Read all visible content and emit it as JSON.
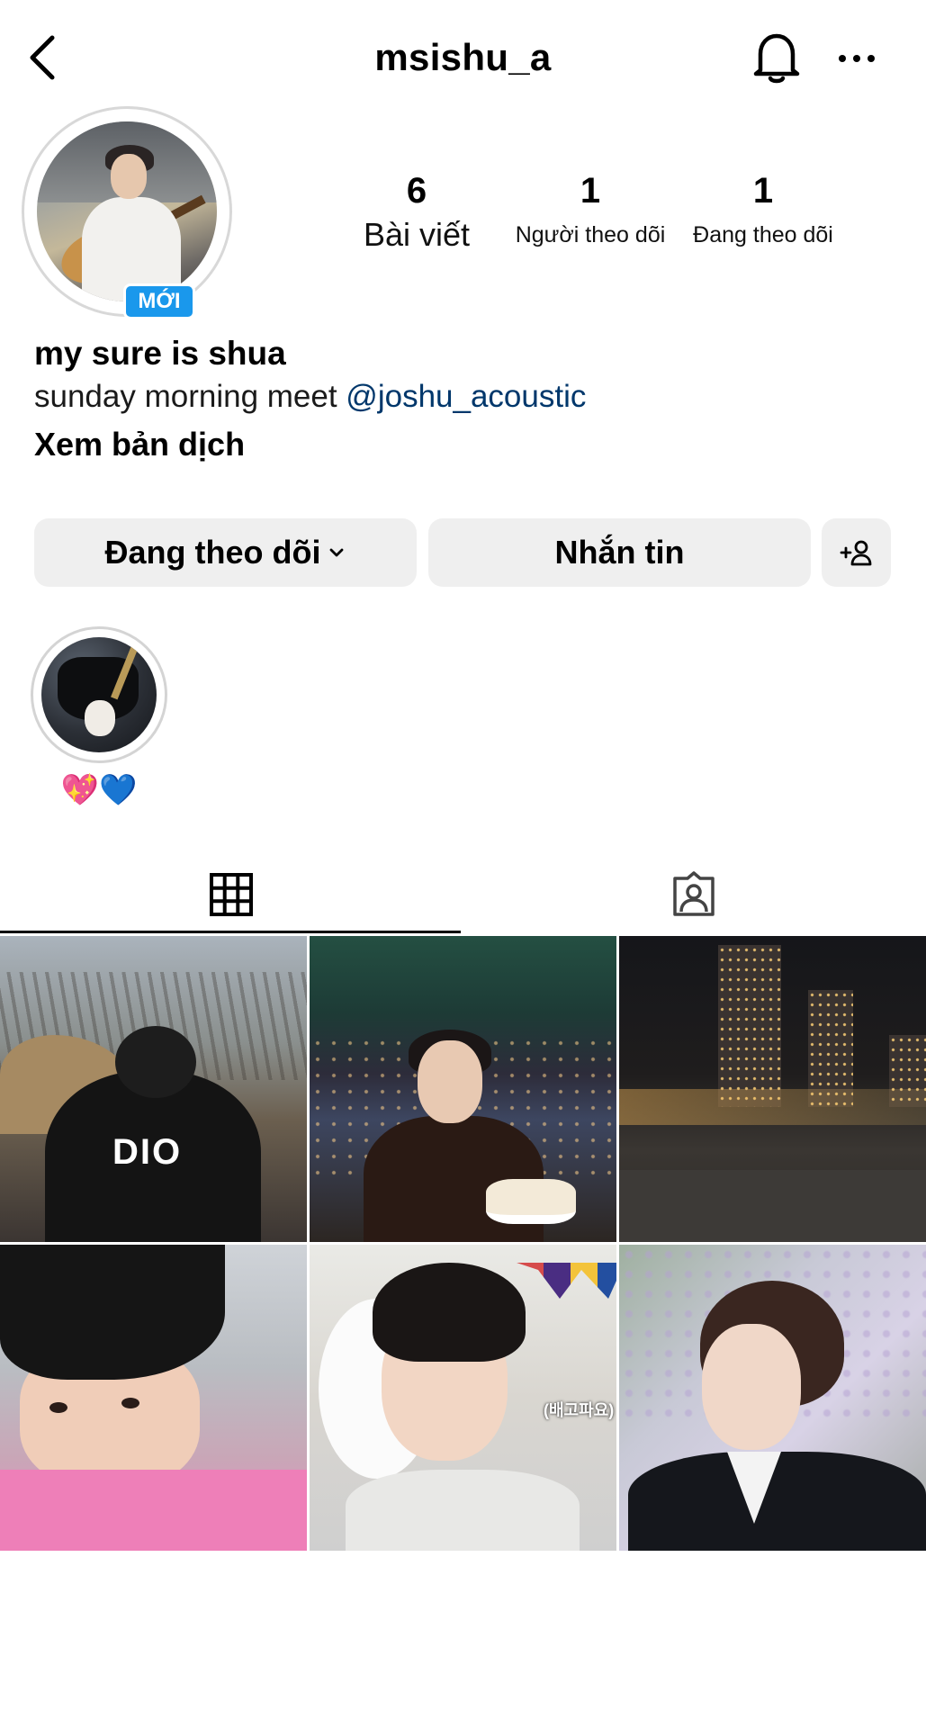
{
  "header": {
    "username": "msishu_a",
    "icons": {
      "back": "chevron-left-icon",
      "notifications": "bell-icon",
      "more": "more-horizontal-icon"
    }
  },
  "profile": {
    "new_badge": "MỚI",
    "stats": {
      "posts": {
        "count": "6",
        "label": "Bài viết"
      },
      "followers": {
        "count": "1",
        "label": "Người theo dõi"
      },
      "following": {
        "count": "1",
        "label": "Đang theo dõi"
      }
    },
    "bio": {
      "name": "my sure is shua",
      "text": "sunday morning meet ",
      "mention": "@joshu_acoustic",
      "translate": "Xem bản dịch"
    }
  },
  "actions": {
    "following_label": "Đang theo dõi",
    "message_label": "Nhắn tin",
    "add_user_icon": "add-user-icon"
  },
  "highlights": [
    {
      "label": "💖💙"
    }
  ],
  "tabs": {
    "posts_icon": "grid-icon",
    "tagged_icon": "tagged-portrait-icon",
    "active": "posts"
  },
  "posts": [
    {
      "text": "DIO"
    },
    {
      "text": ""
    },
    {
      "text": ""
    },
    {
      "text": ""
    },
    {
      "text": "(배고파요)"
    },
    {
      "text": ""
    }
  ],
  "colors": {
    "badge_blue": "#1a98ec",
    "mention_blue": "#00376b",
    "button_bg": "#efefef"
  }
}
